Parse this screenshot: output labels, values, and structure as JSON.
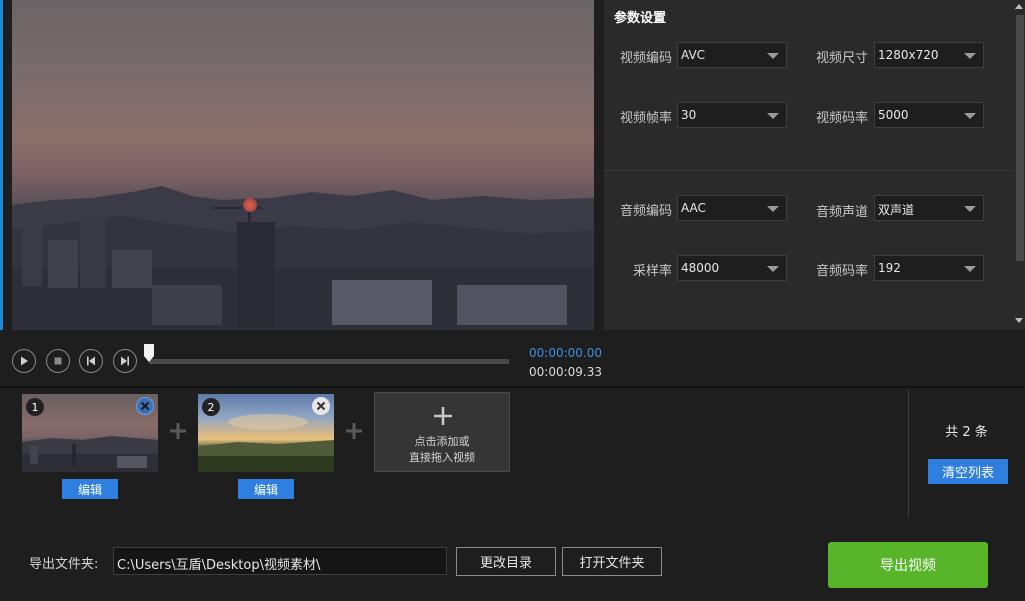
{
  "player": {
    "current_time": "00:00:00.00",
    "total_time": "00:00:09.33",
    "progress": 0.0
  },
  "settings": {
    "title": "参数设置",
    "video": {
      "codec": {
        "label": "视频编码",
        "value": "AVC"
      },
      "size": {
        "label": "视频尺寸",
        "value": "1280x720"
      },
      "framerate": {
        "label": "视频帧率",
        "value": "30"
      },
      "bitrate": {
        "label": "视频码率",
        "value": "5000"
      }
    },
    "audio": {
      "codec": {
        "label": "音频编码",
        "value": "AAC"
      },
      "channels": {
        "label": "音频声道",
        "value": "双声道"
      },
      "samplerate": {
        "label": "采样率",
        "value": "48000"
      },
      "bitrate": {
        "label": "音频码率",
        "value": "192"
      }
    }
  },
  "clips": {
    "items": [
      {
        "number": "1",
        "edit_label": "编辑"
      },
      {
        "number": "2",
        "edit_label": "编辑"
      }
    ],
    "add_tile": {
      "line1": "点击添加或",
      "line2": "直接拖入视频"
    },
    "count_label": "共 2 条",
    "clear_label": "清空列表"
  },
  "footer": {
    "folder_label": "导出文件夹:",
    "path_value": "C:\\Users\\互盾\\Desktop\\视频素材\\",
    "change_dir_label": "更改目录",
    "open_folder_label": "打开文件夹",
    "export_label": "导出视频"
  },
  "colors": {
    "accent_blue": "#2f7fe0",
    "export_green": "#58b52a",
    "time_blue": "#3d8fe0"
  }
}
